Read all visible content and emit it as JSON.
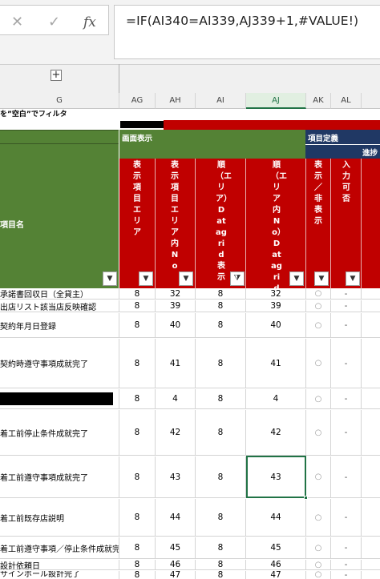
{
  "formula_bar": {
    "cancel_icon": "✕",
    "enter_icon": "✓",
    "fx_label": "fx",
    "formula": "=IF(AI340=AI339,AJ339+1,#VALUE!)"
  },
  "outline": {
    "expand_symbol": "+"
  },
  "columns": [
    "G",
    "AG",
    "AH",
    "AI",
    "AJ",
    "AK",
    "AL"
  ],
  "active_column": "AJ",
  "filter_note": "を”空白”でフィルタ",
  "group_headers": {
    "display": "画面表示",
    "definition": "項目定義",
    "progress": "進捗"
  },
  "item_name_label": "項目名",
  "field_headers": [
    "表示項目エリア",
    "表示項目エリア内No",
    "順（エリア）Datagrid表示",
    "順（エリア内No）Datagrid表示",
    "表示／非表示",
    "入力可否"
  ],
  "filter_icon": "▼",
  "filter_active_icon": "⧩",
  "rows": [
    {
      "name": "承諾書回収日（全貸主）",
      "ag": "8",
      "ah": "32",
      "ai": "8",
      "aj": "32",
      "ak": "○",
      "al": "-"
    },
    {
      "name": "出店リスト該当店反映確認",
      "ag": "8",
      "ah": "39",
      "ai": "8",
      "aj": "39",
      "ak": "○",
      "al": "-"
    },
    {
      "name": "契約年月日登録",
      "ag": "8",
      "ah": "40",
      "ai": "8",
      "aj": "40",
      "ak": "○",
      "al": "-"
    },
    {
      "name": "契約時遵守事項成就完了",
      "ag": "8",
      "ah": "41",
      "ai": "8",
      "aj": "41",
      "ak": "○",
      "al": "-"
    },
    {
      "name": "",
      "ag": "8",
      "ah": "4",
      "ai": "8",
      "aj": "4",
      "ak": "○",
      "al": "-"
    },
    {
      "name": "着工前停止条件成就完了",
      "ag": "8",
      "ah": "42",
      "ai": "8",
      "aj": "42",
      "ak": "○",
      "al": "-"
    },
    {
      "name": "着工前遵守事項成就完了",
      "ag": "8",
      "ah": "43",
      "ai": "8",
      "aj": "43",
      "ak": "○",
      "al": "-"
    },
    {
      "name": "着工前既存店説明",
      "ag": "8",
      "ah": "44",
      "ai": "8",
      "aj": "44",
      "ak": "○",
      "al": "-"
    },
    {
      "name": "着工前遵守事項／停止条件成就完了",
      "ag": "8",
      "ah": "45",
      "ai": "8",
      "aj": "45",
      "ak": "○",
      "al": "-"
    },
    {
      "name": "設計依頼日",
      "ag": "8",
      "ah": "46",
      "ai": "8",
      "aj": "46",
      "ak": "○",
      "al": "-"
    },
    {
      "name": "サインポール設計完了",
      "ag": "8",
      "ah": "47",
      "ai": "8",
      "aj": "47",
      "ak": "○",
      "al": "-"
    }
  ]
}
